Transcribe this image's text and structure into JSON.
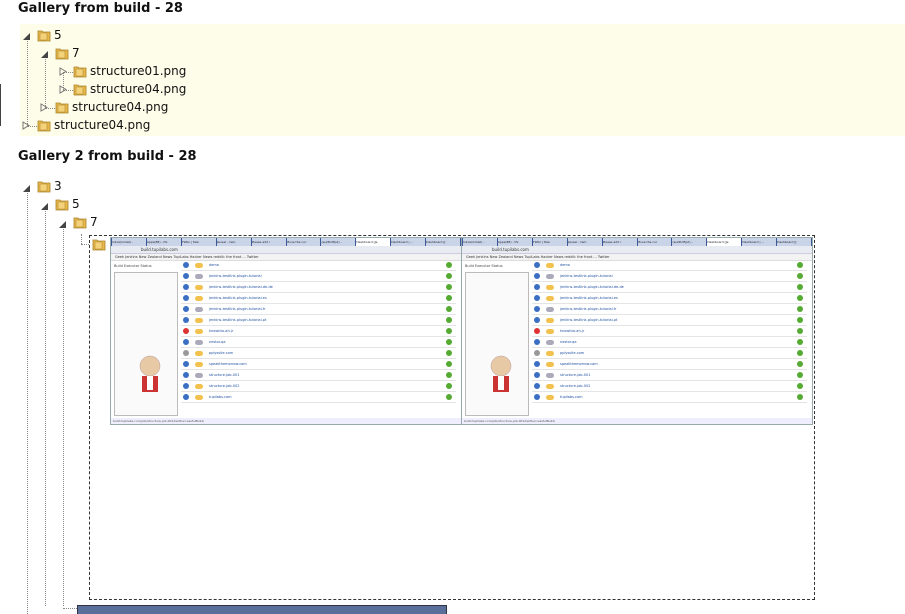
{
  "galleries": [
    {
      "title": "Gallery from build - 28",
      "tree": {
        "root": "5",
        "child": "7",
        "files_in_7": [
          "structure01.png",
          "structure04.png"
        ],
        "file_in_5": "structure04.png",
        "file_at_root": "structure04.png"
      }
    },
    {
      "title": "Gallery 2 from build - 28",
      "tree": {
        "root": "3",
        "child": "5",
        "grandchild": "7"
      }
    }
  ],
  "screenshot": {
    "url": "build.tupilabs.com",
    "tabs": [
      "Inbox(Gmail) -",
      "Apps(88) - thi",
      "TWiki | Tele",
      "Jisuser - tem",
      "Please add i",
      "Move the cur",
      "(ssl/Proftpd) -",
      "Dashboard [Je",
      "Dashboard | ...",
      "Dashboard [J"
    ],
    "bookmarks": "Geek  Jenkins  New Zealand  News  TupiLabs  Hacker News  reddit: the front ...  Twitter",
    "side_title": "Build Executor Status",
    "jobs": [
      "demo",
      "jenkins-testlink-plugin-tutorial",
      "jenkins-testlink-plugin-tutorial-de-de",
      "jenkins-testlink-plugin-tutorial-es",
      "jenkins-testlink-plugin-tutorial-fr",
      "jenkins-testlink-plugin-tutorial-pt",
      "knowhto-ah-jr",
      "nestor-qa",
      "pplyssite.com",
      "speakthemorrow.com",
      "structure-job-001",
      "structure-job-002",
      "tupilabs.com"
    ],
    "footer": "build.tupilabs.com/job/structure-job-001/lastSuccessfulBuild/"
  },
  "colors": {
    "panel_bg": "#fefde9",
    "folder": "#e8b84a",
    "jenkins_blue": "#3b6fc4"
  }
}
